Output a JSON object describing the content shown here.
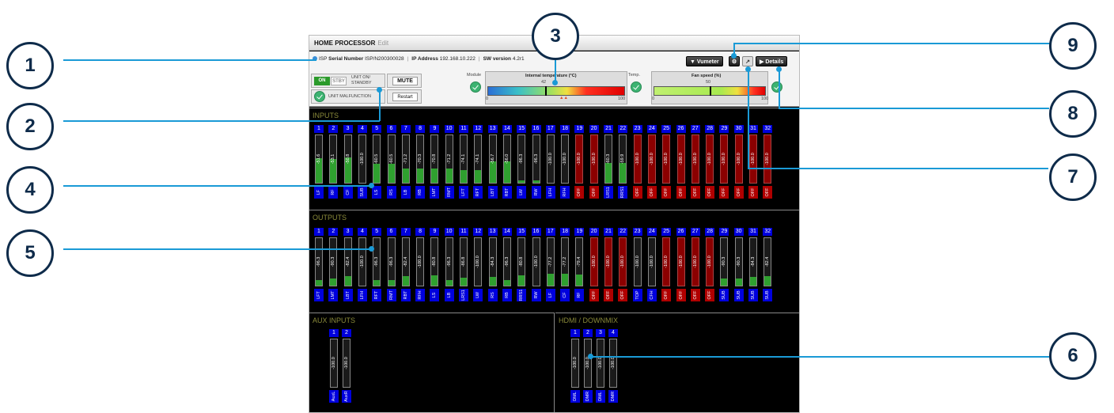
{
  "title": {
    "app": "HOME PROCESSOR",
    "edit": "Edit"
  },
  "info": {
    "isp": "ISP",
    "serial_label": "Serial Number",
    "serial": "ISP/N200300028",
    "ip_label": "IP Address",
    "ip": "192.168.10.222",
    "sw_label": "SW version",
    "sw": "4.2r1"
  },
  "toolbar": {
    "vumeter": "Vumeter",
    "details": "Details"
  },
  "unit": {
    "on": "ON",
    "stby": "STBY",
    "on_standby": "UNIT ON/ STANDBY",
    "mute": "MUTE",
    "malfunction": "UNIT MALFUNCTION",
    "restart": "Restart"
  },
  "module_label": "Module",
  "temp_label": "Temp.",
  "temperature": {
    "title": "Internal temperature (°C)",
    "value": "42",
    "min": "0",
    "max": "100",
    "level": 0.42
  },
  "fan": {
    "title": "Fan speed (%)",
    "value": "50",
    "min": "0",
    "max": "100",
    "level": 0.5
  },
  "inputs": {
    "title": "INPUTS",
    "channels": [
      {
        "n": "1",
        "v": "-51.6",
        "l": "LF",
        "red": false,
        "fill": 0.52
      },
      {
        "n": "2",
        "v": "-53.1",
        "l": "RF",
        "red": false,
        "fill": 0.5
      },
      {
        "n": "3",
        "v": "-50.8",
        "l": "CF",
        "red": false,
        "fill": 0.53
      },
      {
        "n": "4",
        "v": "-100.0",
        "l": "SUB",
        "red": false,
        "fill": 0
      },
      {
        "n": "5",
        "v": "-60.5",
        "l": "LS",
        "red": false,
        "fill": 0.4
      },
      {
        "n": "6",
        "v": "-60.5",
        "l": "RS",
        "red": false,
        "fill": 0.4
      },
      {
        "n": "7",
        "v": "-71.2",
        "l": "LB",
        "red": false,
        "fill": 0.3
      },
      {
        "n": "8",
        "v": "-70.3",
        "l": "RB",
        "red": false,
        "fill": 0.3
      },
      {
        "n": "9",
        "v": "-70.8",
        "l": "LMT",
        "red": false,
        "fill": 0.3
      },
      {
        "n": "10",
        "v": "-71.2",
        "l": "RMT",
        "red": false,
        "fill": 0.3
      },
      {
        "n": "11",
        "v": "-74.1",
        "l": "LFT",
        "red": false,
        "fill": 0.27
      },
      {
        "n": "12",
        "v": "-74.1",
        "l": "RFT",
        "red": false,
        "fill": 0.27
      },
      {
        "n": "13",
        "v": "-56.7",
        "l": "LBT",
        "red": false,
        "fill": 0.45
      },
      {
        "n": "14",
        "v": "-56.0",
        "l": "RBT",
        "red": false,
        "fill": 0.45
      },
      {
        "n": "15",
        "v": "-96.3",
        "l": "LW",
        "red": false,
        "fill": 0.05
      },
      {
        "n": "16",
        "v": "-96.3",
        "l": "RW",
        "red": false,
        "fill": 0.05
      },
      {
        "n": "17",
        "v": "-100.0",
        "l": "LFH",
        "red": false,
        "fill": 0
      },
      {
        "n": "18",
        "v": "-100.0",
        "l": "RFH",
        "red": false,
        "fill": 0
      },
      {
        "n": "19",
        "v": "-100.0",
        "l": "OFF",
        "red": true,
        "fill": 0
      },
      {
        "n": "20",
        "v": "-100.0",
        "l": "OFF",
        "red": true,
        "fill": 0
      },
      {
        "n": "21",
        "v": "-60.3",
        "l": "LRS1",
        "red": false,
        "fill": 0.42
      },
      {
        "n": "22",
        "v": "-59.9",
        "l": "RRS1",
        "red": false,
        "fill": 0.42
      },
      {
        "n": "23",
        "v": "-100.0",
        "l": "OFF",
        "red": true,
        "fill": 0
      },
      {
        "n": "24",
        "v": "-100.0",
        "l": "OFF",
        "red": true,
        "fill": 0
      },
      {
        "n": "25",
        "v": "-100.0",
        "l": "OFF",
        "red": true,
        "fill": 0
      },
      {
        "n": "26",
        "v": "-100.0",
        "l": "OFF",
        "red": true,
        "fill": 0
      },
      {
        "n": "27",
        "v": "-100.0",
        "l": "OFF",
        "red": true,
        "fill": 0
      },
      {
        "n": "28",
        "v": "-100.0",
        "l": "OFF",
        "red": true,
        "fill": 0
      },
      {
        "n": "29",
        "v": "-100.0",
        "l": "OFF",
        "red": true,
        "fill": 0
      },
      {
        "n": "30",
        "v": "-100.0",
        "l": "OFF",
        "red": true,
        "fill": 0
      },
      {
        "n": "31",
        "v": "-100.0",
        "l": "OFF",
        "red": true,
        "fill": 0
      },
      {
        "n": "32",
        "v": "-100.0",
        "l": "OFF",
        "red": true,
        "fill": 0
      }
    ]
  },
  "outputs": {
    "title": "OUTPUTS",
    "channels": [
      {
        "n": "1",
        "v": "-96.3",
        "l": "LFT",
        "red": false,
        "fill": 0.12
      },
      {
        "n": "2",
        "v": "-90.3",
        "l": "LMT",
        "red": false,
        "fill": 0.15
      },
      {
        "n": "3",
        "v": "-82.4",
        "l": "LBT",
        "red": false,
        "fill": 0.2
      },
      {
        "n": "4",
        "v": "-100.0",
        "l": "LFH",
        "red": false,
        "fill": 0
      },
      {
        "n": "5",
        "v": "-96.3",
        "l": "RFT",
        "red": false,
        "fill": 0.12
      },
      {
        "n": "6",
        "v": "-96.3",
        "l": "RMT",
        "red": false,
        "fill": 0.12
      },
      {
        "n": "7",
        "v": "-82.4",
        "l": "RBT",
        "red": false,
        "fill": 0.2
      },
      {
        "n": "8",
        "v": "-100.0",
        "l": "RFH",
        "red": false,
        "fill": 0
      },
      {
        "n": "9",
        "v": "-80.8",
        "l": "LS",
        "red": false,
        "fill": 0.22
      },
      {
        "n": "10",
        "v": "-96.3",
        "l": "LB",
        "red": false,
        "fill": 0.12
      },
      {
        "n": "11",
        "v": "-86.8",
        "l": "LRS1",
        "red": false,
        "fill": 0.17
      },
      {
        "n": "12",
        "v": "-100.0",
        "l": "LW",
        "red": false,
        "fill": 0
      },
      {
        "n": "13",
        "v": "-84.3",
        "l": "RS",
        "red": false,
        "fill": 0.18
      },
      {
        "n": "14",
        "v": "-96.3",
        "l": "RB",
        "red": false,
        "fill": 0.12
      },
      {
        "n": "15",
        "v": "-80.8",
        "l": "RRS1",
        "red": false,
        "fill": 0.22
      },
      {
        "n": "16",
        "v": "-100.0",
        "l": "RW",
        "red": false,
        "fill": 0
      },
      {
        "n": "17",
        "v": "-77.2",
        "l": "LF",
        "red": false,
        "fill": 0.25
      },
      {
        "n": "18",
        "v": "-77.2",
        "l": "CF",
        "red": false,
        "fill": 0.25
      },
      {
        "n": "19",
        "v": "-79.4",
        "l": "RF",
        "red": false,
        "fill": 0.23
      },
      {
        "n": "20",
        "v": "-100.0",
        "l": "OFF",
        "red": true,
        "fill": 0
      },
      {
        "n": "21",
        "v": "-100.0",
        "l": "OFF",
        "red": true,
        "fill": 0
      },
      {
        "n": "22",
        "v": "-100.0",
        "l": "OFF",
        "red": true,
        "fill": 0
      },
      {
        "n": "23",
        "v": "-100.0",
        "l": "TOP",
        "red": false,
        "fill": 0
      },
      {
        "n": "24",
        "v": "-100.0",
        "l": "CFH",
        "red": false,
        "fill": 0
      },
      {
        "n": "25",
        "v": "-100.0",
        "l": "OFF",
        "red": true,
        "fill": 0
      },
      {
        "n": "26",
        "v": "-100.0",
        "l": "OFF",
        "red": true,
        "fill": 0
      },
      {
        "n": "27",
        "v": "-100.0",
        "l": "OFF",
        "red": true,
        "fill": 0
      },
      {
        "n": "28",
        "v": "-100.0",
        "l": "OFF",
        "red": true,
        "fill": 0
      },
      {
        "n": "29",
        "v": "-90.3",
        "l": "SUB",
        "red": false,
        "fill": 0.15
      },
      {
        "n": "30",
        "v": "-90.3",
        "l": "SUB",
        "red": false,
        "fill": 0.15
      },
      {
        "n": "31",
        "v": "-84.3",
        "l": "SUB",
        "red": false,
        "fill": 0.18
      },
      {
        "n": "32",
        "v": "-82.4",
        "l": "SUB",
        "red": false,
        "fill": 0.2
      }
    ]
  },
  "aux": {
    "title": "AUX INPUTS",
    "channels": [
      {
        "n": "1",
        "v": "-100.0",
        "l": "AuxL",
        "red": false,
        "fill": 0
      },
      {
        "n": "2",
        "v": "-100.0",
        "l": "AuxR",
        "red": false,
        "fill": 0
      }
    ]
  },
  "hdmi": {
    "title": "HDMI / DOWNMIX",
    "channels": [
      {
        "n": "1",
        "v": "-100.0",
        "l": "DML",
        "red": false,
        "fill": 0
      },
      {
        "n": "2",
        "v": "-100.0",
        "l": "DMR",
        "red": false,
        "fill": 0
      },
      {
        "n": "3",
        "v": "-100.0",
        "l": "DML",
        "red": false,
        "fill": 0
      },
      {
        "n": "4",
        "v": "-100.0",
        "l": "DMR",
        "red": false,
        "fill": 0
      }
    ]
  },
  "callouts": [
    "1",
    "2",
    "3",
    "4",
    "5",
    "6",
    "7",
    "8",
    "9"
  ],
  "colors": {
    "accent": "#1a9ad6",
    "channel_blue": "#0000dd",
    "off_red": "#b00000",
    "meter_green": "#2fa02f",
    "callout_border": "#0e2b4a"
  }
}
